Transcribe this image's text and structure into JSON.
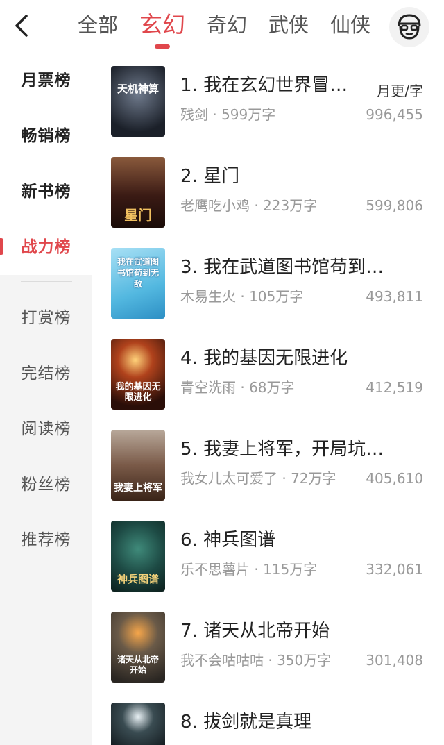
{
  "header": {
    "tabs": [
      {
        "label": "全部",
        "active": false
      },
      {
        "label": "玄幻",
        "active": true
      },
      {
        "label": "奇幻",
        "active": false
      },
      {
        "label": "武侠",
        "active": false
      },
      {
        "label": "仙侠",
        "active": false
      }
    ],
    "accent_color": "#e0474c"
  },
  "sidebar": {
    "items": [
      {
        "label": "月票榜"
      },
      {
        "label": "畅销榜"
      },
      {
        "label": "新书榜"
      },
      {
        "label": "战力榜",
        "active": true
      },
      {
        "label": "打赏榜"
      },
      {
        "label": "完结榜"
      },
      {
        "label": "阅读榜"
      },
      {
        "label": "粉丝榜"
      },
      {
        "label": "推荐榜"
      }
    ]
  },
  "list": {
    "metric_label": "月更/字",
    "books": [
      {
        "title": "1. 我在玄幻世界冒…",
        "author": "残剑",
        "words": "599万字",
        "value": "996,455",
        "cover_text": "天机神算",
        "cover_color": "#2b3140"
      },
      {
        "title": "2. 星门",
        "author": "老鹰吃小鸡",
        "words": "223万字",
        "value": "599,806",
        "cover_text": "星门",
        "cover_color": "#5a2a1e"
      },
      {
        "title": "3. 我在武道图书馆苟到…",
        "author": "木易生火",
        "words": "105万字",
        "value": "493,811",
        "cover_text": "我在武道图书馆苟到无敌",
        "cover_color": "#3fa9d6"
      },
      {
        "title": "4. 我的基因无限进化",
        "author": "青空洗雨",
        "words": "68万字",
        "value": "412,519",
        "cover_text": "我的基因无限进化",
        "cover_color": "#3a1a12"
      },
      {
        "title": "5. 我妻上将军，开局坑…",
        "author": "我女儿太可爱了",
        "words": "72万字",
        "value": "405,610",
        "cover_text": "我妻上将军",
        "cover_color": "#6b4a3a"
      },
      {
        "title": "6. 神兵图谱",
        "author": "乐不思薯片",
        "words": "115万字",
        "value": "332,061",
        "cover_text": "神兵图谱",
        "cover_color": "#1d4a44"
      },
      {
        "title": "7. 诸天从北帝开始",
        "author": "我不会咕咕咕",
        "words": "350万字",
        "value": "301,408",
        "cover_text": "诸天从北帝开始",
        "cover_color": "#4a4640"
      },
      {
        "title": "8. 拔剑就是真理",
        "author": "",
        "words": "",
        "value": "",
        "cover_text": "",
        "cover_color": "#1a1f24"
      }
    ]
  }
}
